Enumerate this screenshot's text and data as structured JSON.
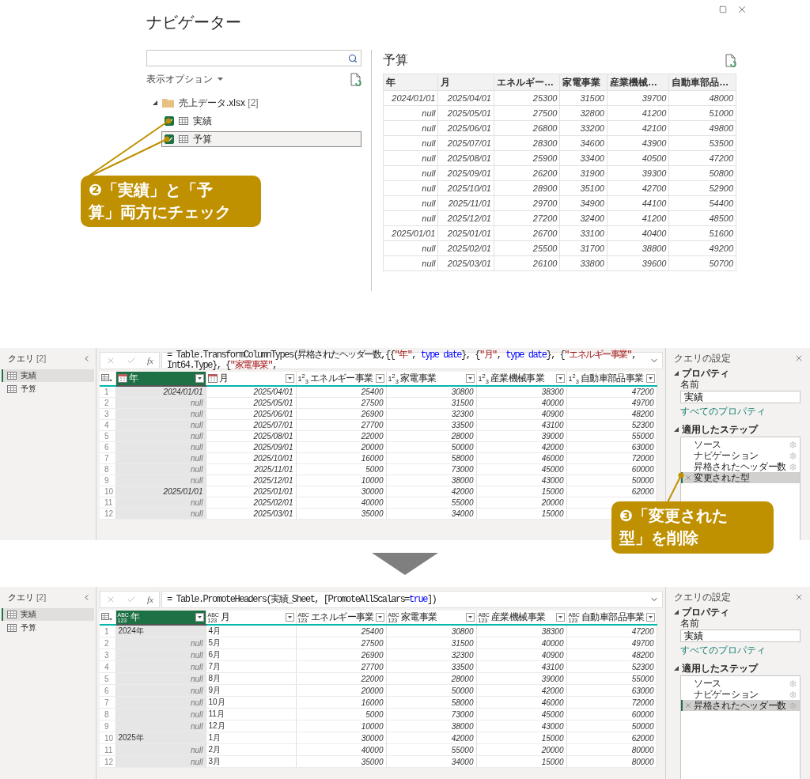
{
  "navigator": {
    "title": "ナビゲーター",
    "display_options": "表示オプション",
    "tree": {
      "label": "売上データ.xlsx",
      "count": "[2]",
      "expanded": true,
      "children": [
        {
          "label": "実績",
          "checked": true,
          "selected": false
        },
        {
          "label": "予算",
          "checked": true,
          "selected": true
        }
      ]
    },
    "preview": {
      "title": "予算",
      "columns": [
        "年",
        "月",
        "エネルギー…",
        "家電事業",
        "産業機械…",
        "自動車部品…"
      ],
      "rows": [
        [
          "2024/01/01",
          "2025/04/01",
          "25300",
          "31500",
          "39700",
          "48000"
        ],
        [
          "null",
          "2025/05/01",
          "27500",
          "32800",
          "41200",
          "51000"
        ],
        [
          "null",
          "2025/06/01",
          "26800",
          "33200",
          "42100",
          "49800"
        ],
        [
          "null",
          "2025/07/01",
          "28300",
          "34600",
          "43900",
          "53500"
        ],
        [
          "null",
          "2025/08/01",
          "25900",
          "33400",
          "40500",
          "47200"
        ],
        [
          "null",
          "2025/09/01",
          "26200",
          "31900",
          "39300",
          "50800"
        ],
        [
          "null",
          "2025/10/01",
          "28900",
          "35100",
          "42700",
          "52900"
        ],
        [
          "null",
          "2025/11/01",
          "29700",
          "34900",
          "44100",
          "54400"
        ],
        [
          "null",
          "2025/12/01",
          "27200",
          "32400",
          "41200",
          "48500"
        ],
        [
          "2025/01/01",
          "2025/01/01",
          "26700",
          "33100",
          "40400",
          "51600"
        ],
        [
          "null",
          "2025/02/01",
          "25500",
          "31700",
          "38800",
          "49200"
        ],
        [
          "null",
          "2025/03/01",
          "26100",
          "33800",
          "39600",
          "50700"
        ]
      ]
    }
  },
  "callouts": [
    {
      "lines": [
        "❷「実績」と「予",
        "算」両方にチェック"
      ]
    },
    {
      "lines": [
        "❸「変更された",
        "型」を削除"
      ]
    }
  ],
  "editors": [
    {
      "queries": {
        "title": "クエリ",
        "count": "[2]",
        "items": [
          {
            "label": "実績",
            "selected": true
          },
          {
            "label": "予算",
            "selected": false
          }
        ]
      },
      "fx": "fx",
      "formula": [
        {
          "t": "= Table.TransformColumnTypes(昇格されたヘッダー数,{{",
          "kind": "plain"
        },
        {
          "t": "\"年\"",
          "kind": "string"
        },
        {
          "t": ", ",
          "kind": "plain"
        },
        {
          "t": "type date",
          "kind": "keyword"
        },
        {
          "t": "}, {",
          "kind": "plain"
        },
        {
          "t": "\"月\"",
          "kind": "string"
        },
        {
          "t": ", ",
          "kind": "plain"
        },
        {
          "t": "type date",
          "kind": "keyword"
        },
        {
          "t": "}, {",
          "kind": "plain"
        },
        {
          "t": "\"エネルギー事業\"",
          "kind": "string"
        },
        {
          "t": ", Int64.Type}, {",
          "kind": "plain"
        },
        {
          "t": "\"家電事業\"",
          "kind": "string"
        },
        {
          "t": ",",
          "kind": "plain"
        }
      ],
      "columns": [
        {
          "label": "年",
          "kind": "date",
          "text_values": false,
          "selected": true
        },
        {
          "label": "月",
          "kind": "date",
          "text_values": false,
          "selected": false
        },
        {
          "label": "エネルギー事業",
          "kind": "int",
          "type_text": [
            "1$^{2}$$_{3}$"
          ],
          "text_values": false,
          "selected": false
        },
        {
          "label": "家電事業",
          "kind": "int",
          "type_text": [
            "1$^{2}$$_{3}$"
          ],
          "text_values": false,
          "selected": false
        },
        {
          "label": "産業機械事業",
          "kind": "int",
          "type_text": [
            "1$^{2}$$_{3}$"
          ],
          "text_values": false,
          "selected": false
        },
        {
          "label": "自動車部品事業",
          "kind": "int",
          "type_text": [
            "1$^{2}$$_{3}$"
          ],
          "text_values": false,
          "selected": false
        }
      ],
      "rows": [
        {
          "n": "1",
          "cells": [
            "2024/01/01",
            "2025/04/01",
            "25400",
            "30800",
            "38300",
            "47200"
          ]
        },
        {
          "n": "2",
          "cells": [
            {
              "text": "null",
              "is_null": true
            },
            "2025/05/01",
            "27500",
            "31500",
            "40000",
            "49700"
          ]
        },
        {
          "n": "3",
          "cells": [
            {
              "text": "null",
              "is_null": true
            },
            "2025/06/01",
            "26900",
            "32300",
            "40900",
            "48200"
          ]
        },
        {
          "n": "4",
          "cells": [
            {
              "text": "null",
              "is_null": true
            },
            "2025/07/01",
            "27700",
            "33500",
            "43100",
            "52300"
          ]
        },
        {
          "n": "5",
          "cells": [
            {
              "text": "null",
              "is_null": true
            },
            "2025/08/01",
            "22000",
            "28000",
            "39000",
            "55000"
          ]
        },
        {
          "n": "6",
          "cells": [
            {
              "text": "null",
              "is_null": true
            },
            "2025/09/01",
            "20000",
            "50000",
            "42000",
            "63000"
          ]
        },
        {
          "n": "7",
          "cells": [
            {
              "text": "null",
              "is_null": true
            },
            "2025/10/01",
            "16000",
            "58000",
            "46000",
            "72000"
          ]
        },
        {
          "n": "8",
          "cells": [
            {
              "text": "null",
              "is_null": true
            },
            "2025/11/01",
            "5000",
            "73000",
            "45000",
            "60000"
          ]
        },
        {
          "n": "9",
          "cells": [
            {
              "text": "null",
              "is_null": true
            },
            "2025/12/01",
            "10000",
            "38000",
            "43000",
            "50000"
          ]
        },
        {
          "n": "10",
          "cells": [
            "2025/01/01",
            "2025/01/01",
            "30000",
            "42000",
            "15000",
            "62000"
          ]
        },
        {
          "n": "11",
          "cells": [
            {
              "text": "null",
              "is_null": true
            },
            "2025/02/01",
            "40000",
            "55000",
            "20000"
          ]
        },
        {
          "n": "12",
          "cells": [
            {
              "text": "null",
              "is_null": true
            },
            "2025/03/01",
            "35000",
            "34000",
            "15000"
          ]
        }
      ],
      "settings": {
        "title": "クエリの設定",
        "properties": "プロパティ",
        "name_label": "名前",
        "name_value": "実績",
        "all_properties": "すべてのプロパティ",
        "steps_title": "適用したステップ",
        "steps": [
          {
            "label": "ソース",
            "selected": false,
            "has_settings": true
          },
          {
            "label": "ナビゲーション",
            "selected": false,
            "has_settings": true
          },
          {
            "label": "昇格されたヘッダー数",
            "selected": false,
            "has_settings": true
          },
          {
            "label": "変更された型",
            "selected": true,
            "has_settings": false
          }
        ]
      }
    },
    {
      "queries": {
        "title": "クエリ",
        "count": "[2]",
        "items": [
          {
            "label": "実績",
            "selected": true
          },
          {
            "label": "予算",
            "selected": false
          }
        ]
      },
      "fx": "fx",
      "formula": [
        {
          "t": "= Table.PromoteHeaders(実績_Sheet, [PromoteAllScalars=",
          "kind": "plain"
        },
        {
          "t": "true",
          "kind": "keyword"
        },
        {
          "t": "])",
          "kind": "plain"
        }
      ],
      "columns": [
        {
          "label": "年",
          "kind": "any",
          "type_text": [
            "ABC",
            "123"
          ],
          "text_values": true,
          "selected": true
        },
        {
          "label": "月",
          "kind": "any",
          "type_text": [
            "ABC",
            "123"
          ],
          "text_values": true,
          "selected": false
        },
        {
          "label": "エネルギー事業",
          "kind": "any",
          "type_text": [
            "ABC",
            "123"
          ],
          "text_values": false,
          "selected": false
        },
        {
          "label": "家電事業",
          "kind": "any",
          "type_text": [
            "ABC",
            "123"
          ],
          "text_values": false,
          "selected": false
        },
        {
          "label": "産業機械事業",
          "kind": "any",
          "type_text": [
            "ABC",
            "123"
          ],
          "text_values": false,
          "selected": false
        },
        {
          "label": "自動車部品事業",
          "kind": "any",
          "type_text": [
            "ABC",
            "123"
          ],
          "text_values": false,
          "selected": false
        }
      ],
      "rows": [
        {
          "n": "1",
          "cells": [
            "2024年",
            "4月",
            "25400",
            "30800",
            "38300",
            "47200"
          ]
        },
        {
          "n": "2",
          "cells": [
            {
              "text": "null",
              "is_null": true
            },
            "5月",
            "27500",
            "31500",
            "40000",
            "49700"
          ]
        },
        {
          "n": "3",
          "cells": [
            {
              "text": "null",
              "is_null": true
            },
            "6月",
            "26900",
            "32300",
            "40900",
            "48200"
          ]
        },
        {
          "n": "4",
          "cells": [
            {
              "text": "null",
              "is_null": true
            },
            "7月",
            "27700",
            "33500",
            "43100",
            "52300"
          ]
        },
        {
          "n": "5",
          "cells": [
            {
              "text": "null",
              "is_null": true
            },
            "8月",
            "22000",
            "28000",
            "39000",
            "55000"
          ]
        },
        {
          "n": "6",
          "cells": [
            {
              "text": "null",
              "is_null": true
            },
            "9月",
            "20000",
            "50000",
            "42000",
            "63000"
          ]
        },
        {
          "n": "7",
          "cells": [
            {
              "text": "null",
              "is_null": true
            },
            "10月",
            "16000",
            "58000",
            "46000",
            "72000"
          ]
        },
        {
          "n": "8",
          "cells": [
            {
              "text": "null",
              "is_null": true
            },
            "11月",
            "5000",
            "73000",
            "45000",
            "60000"
          ]
        },
        {
          "n": "9",
          "cells": [
            {
              "text": "null",
              "is_null": true
            },
            "12月",
            "10000",
            "38000",
            "43000",
            "50000"
          ]
        },
        {
          "n": "10",
          "cells": [
            "2025年",
            "1月",
            "30000",
            "42000",
            "15000",
            "62000"
          ]
        },
        {
          "n": "11",
          "cells": [
            {
              "text": "null",
              "is_null": true
            },
            "2月",
            "40000",
            "55000",
            "20000",
            "80000"
          ]
        },
        {
          "n": "12",
          "cells": [
            {
              "text": "null",
              "is_null": true
            },
            "3月",
            "35000",
            "34000",
            "15000",
            "80000"
          ]
        }
      ],
      "settings": {
        "title": "クエリの設定",
        "properties": "プロパティ",
        "name_label": "名前",
        "name_value": "実績",
        "all_properties": "すべてのプロパティ",
        "steps_title": "適用したステップ",
        "steps": [
          {
            "label": "ソース",
            "selected": false,
            "has_settings": true
          },
          {
            "label": "ナビゲーション",
            "selected": false,
            "has_settings": true
          },
          {
            "label": "昇格されたヘッダー数",
            "selected": true,
            "has_settings": true
          }
        ]
      }
    }
  ]
}
